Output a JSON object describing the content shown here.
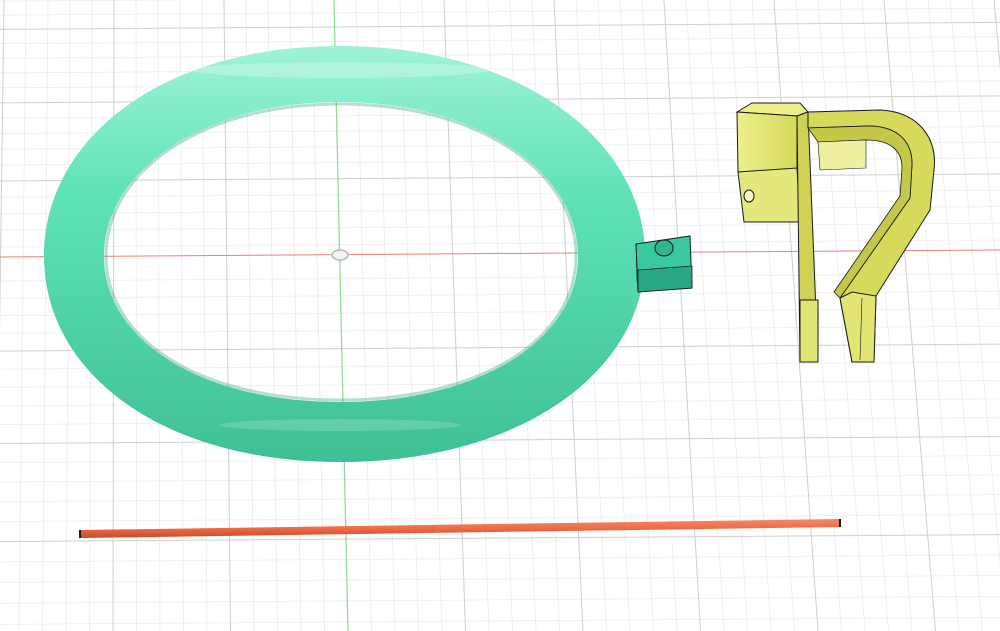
{
  "viewport": {
    "background": "#ffffff",
    "grid_minor_color": "#ececec",
    "grid_major_color": "#cfcfcf",
    "axis_x_color": "#e88080",
    "axis_y_color": "#8fd88f"
  },
  "bodies": [
    {
      "id": "ring",
      "color": "#5fe3b8",
      "shade": "#3fbf95",
      "highlight": "#9ff3d6"
    },
    {
      "id": "ring-tab",
      "color": "#39c9a0",
      "shade": "#1f9a78",
      "edge": "#1a1a1a"
    },
    {
      "id": "clip",
      "color": "#d6d95a",
      "shade": "#a9ad2f",
      "highlight": "#ecef8a",
      "edge": "#1a1a1a"
    },
    {
      "id": "rod",
      "color": "#ef6a45",
      "shade": "#c94a2a",
      "end_cap": "#1a1a1a"
    }
  ],
  "origin_marker": {
    "color": "#b8b8b8"
  }
}
